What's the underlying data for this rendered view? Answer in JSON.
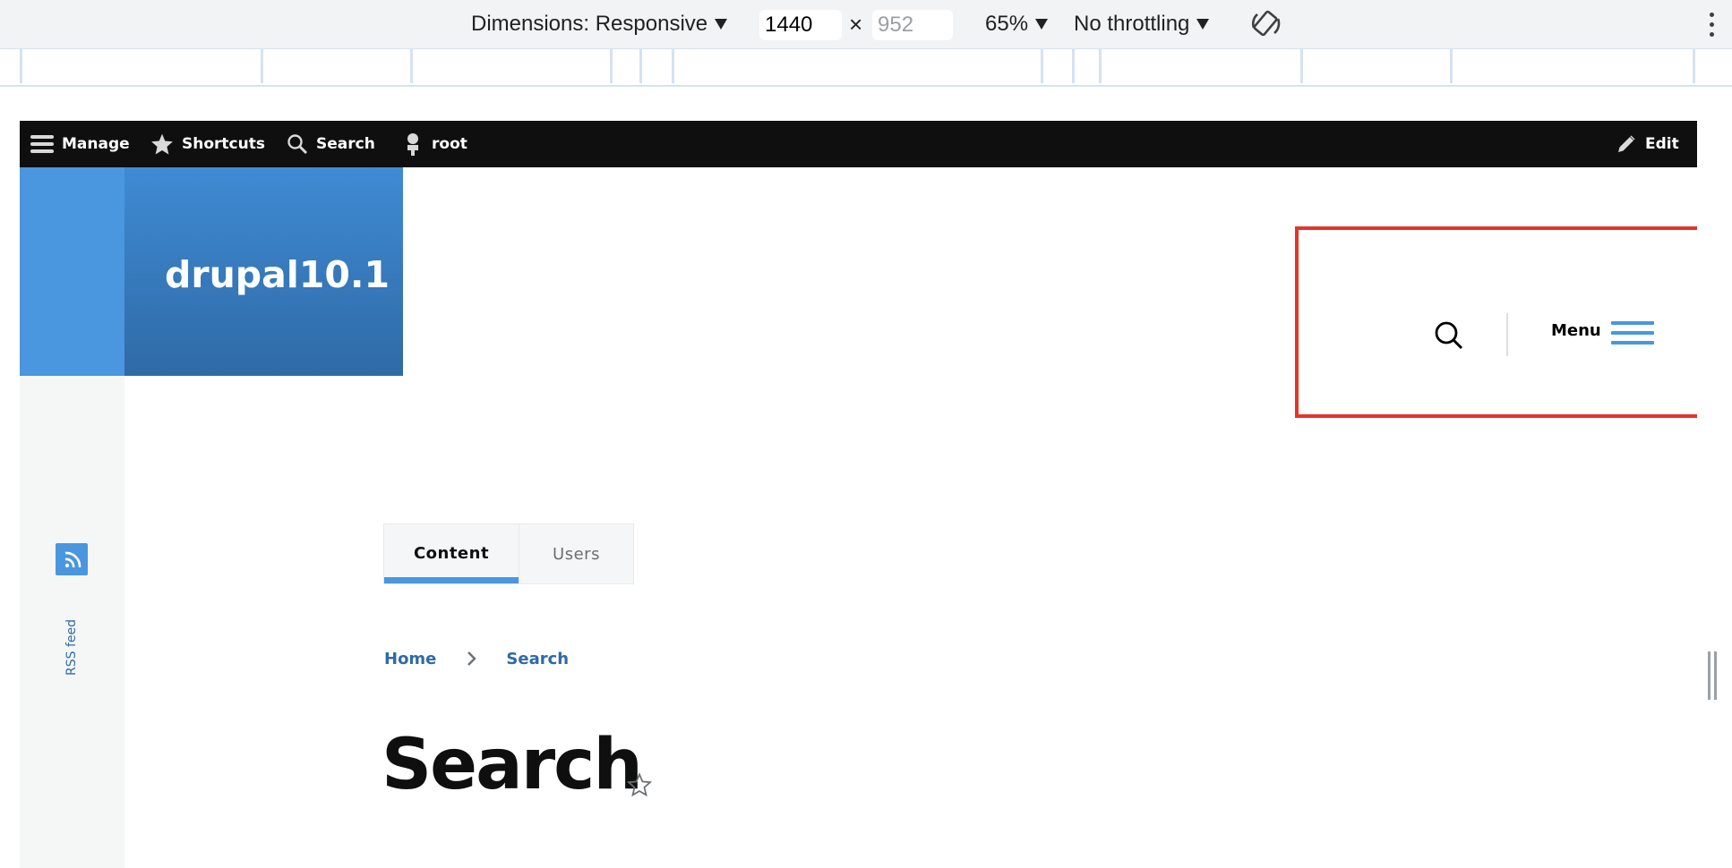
{
  "devtools": {
    "dimensions_label": "Dimensions: Responsive",
    "width_value": "1440",
    "times": "×",
    "height_placeholder": "952",
    "zoom": "65%",
    "throttling": "No throttling"
  },
  "toolbar": {
    "manage": "Manage",
    "shortcuts": "Shortcuts",
    "search": "Search",
    "user": "root",
    "edit": "Edit"
  },
  "site": {
    "name": "drupal10.1",
    "accent_color": "#4a96df"
  },
  "sidebar": {
    "rss_label": "RSS feed"
  },
  "header": {
    "menu_label": "Menu"
  },
  "tabs": [
    {
      "label": "Content",
      "active": true
    },
    {
      "label": "Users",
      "active": false
    }
  ],
  "breadcrumb": [
    {
      "label": "Home"
    },
    {
      "label": "Search"
    }
  ],
  "page": {
    "title": "Search"
  }
}
